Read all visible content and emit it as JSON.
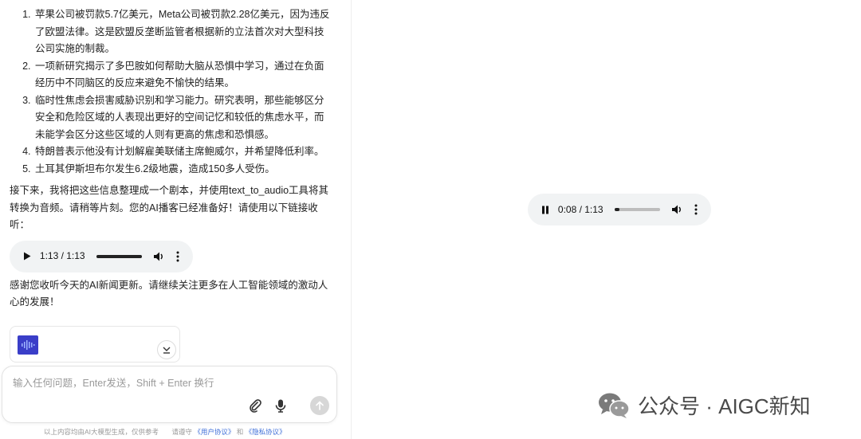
{
  "chat": {
    "news_items": [
      "苹果公司被罚款5.7亿美元，Meta公司被罚款2.28亿美元，因为违反了欧盟法律。这是欧盟反垄断监管者根据新的立法首次对大型科技公司实施的制裁。",
      "一项新研究揭示了多巴胺如何帮助大脑从恐惧中学习，通过在负面经历中不同脑区的反应来避免不愉快的结果。",
      "临时性焦虑会损害威胁识别和学习能力。研究表明，那些能够区分安全和危险区域的人表现出更好的空间记忆和较低的焦虑水平，而未能学会区分这些区域的人则有更高的焦虑和恐惧感。",
      "特朗普表示他没有计划解雇美联储主席鲍威尔，并希望降低利率。",
      "土耳其伊斯坦布尔发生6.2级地震，造成150多人受伤。"
    ],
    "message_1": "接下来，我将把这些信息整理成一个剧本，并使用text_to_audio工具将其转换为音频。请稍等片刻。您的AI播客已经准备好！请使用以下链接收听：",
    "audio_inline": {
      "time": "1:13 / 1:13",
      "progress": 1.0,
      "state": "paused"
    },
    "message_2": "感谢您收听今天的AI新闻更新。请继续关注更多在人工智能领域的激动人心的发展！",
    "file_card": {
      "icon": "audio-file-icon",
      "action_icon": "download-icon"
    }
  },
  "input": {
    "placeholder": "输入任何问题，Enter发送，Shift + Enter 换行",
    "icons": [
      "paperclip-icon",
      "microphone-icon",
      "send-icon"
    ]
  },
  "footer": {
    "disclaimer": "以上内容均由AI大模型生成，仅供参考",
    "agree_prefix": "请遵守",
    "user_agreement": "《用户协议》",
    "and": "和",
    "privacy": "《隐私协议》"
  },
  "preview_audio": {
    "time": "0:08 / 1:13",
    "progress": 0.11,
    "state": "playing"
  },
  "watermark": {
    "text": "公众号 · AIGC新知",
    "icon": "wechat-icon"
  },
  "colors": {
    "accent_blue": "#3a3ec8",
    "link": "#3f6fd8",
    "player_bg": "#f1f3f4"
  }
}
